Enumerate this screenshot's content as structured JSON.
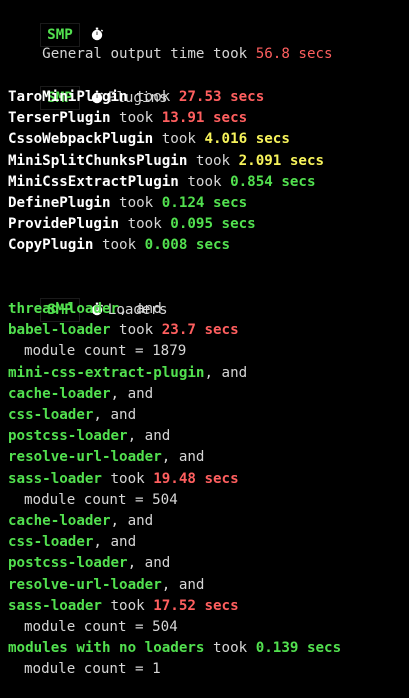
{
  "header": {
    "tag": "SMP",
    "general_line": {
      "prefix": "General output time took ",
      "value": "56.8 secs"
    }
  },
  "plugins": {
    "tag": "SMP",
    "title": "Plugins",
    "items": [
      {
        "name": "TaroMiniPlugin",
        "took": " took ",
        "time": "27.53 secs",
        "color": "#ff5f5f"
      },
      {
        "name": "TerserPlugin",
        "took": " took ",
        "time": "13.91 secs",
        "color": "#ff5f5f"
      },
      {
        "name": "CssoWebpackPlugin",
        "took": " took ",
        "time": "4.016 secs",
        "color": "#f7f35b"
      },
      {
        "name": "MiniSplitChunksPlugin",
        "took": " took ",
        "time": "2.091 secs",
        "color": "#f7f35b"
      },
      {
        "name": "MiniCssExtractPlugin",
        "took": " took ",
        "time": "0.854 secs",
        "color": "#52e04f"
      },
      {
        "name": "DefinePlugin",
        "took": " took ",
        "time": "0.124 secs",
        "color": "#52e04f"
      },
      {
        "name": "ProvidePlugin",
        "took": " took ",
        "time": "0.095 secs",
        "color": "#52e04f"
      },
      {
        "name": "CopyPlugin",
        "took": " took ",
        "time": "0.008 secs",
        "color": "#52e04f"
      }
    ]
  },
  "loaders": {
    "tag": "SMP",
    "title": "Loaders",
    "lines": [
      {
        "type": "name",
        "name": "thread-loader",
        "suffix": ", and"
      },
      {
        "type": "took",
        "name": "babel-loader",
        "took": " took ",
        "time": "23.7 secs",
        "color": "#ff5f5f"
      },
      {
        "type": "count",
        "text": "module count = 1879"
      },
      {
        "type": "name",
        "name": "mini-css-extract-plugin",
        "suffix": ", and"
      },
      {
        "type": "name",
        "name": "cache-loader",
        "suffix": ", and"
      },
      {
        "type": "name",
        "name": "css-loader",
        "suffix": ", and"
      },
      {
        "type": "name",
        "name": "postcss-loader",
        "suffix": ", and"
      },
      {
        "type": "name",
        "name": "resolve-url-loader",
        "suffix": ", and"
      },
      {
        "type": "took",
        "name": "sass-loader",
        "took": " took ",
        "time": "19.48 secs",
        "color": "#ff5f5f"
      },
      {
        "type": "count",
        "text": "module count = 504"
      },
      {
        "type": "name",
        "name": "cache-loader",
        "suffix": ", and"
      },
      {
        "type": "name",
        "name": "css-loader",
        "suffix": ", and"
      },
      {
        "type": "name",
        "name": "postcss-loader",
        "suffix": ", and"
      },
      {
        "type": "name",
        "name": "resolve-url-loader",
        "suffix": ", and"
      },
      {
        "type": "took",
        "name": "sass-loader",
        "took": " took ",
        "time": "17.52 secs",
        "color": "#ff5f5f"
      },
      {
        "type": "count",
        "text": "module count = 504"
      },
      {
        "type": "took",
        "name": "modules with no loaders",
        "took": " took ",
        "time": "0.139 secs",
        "color": "#52e04f"
      },
      {
        "type": "count",
        "text": "module count = 1"
      }
    ]
  },
  "icons": {
    "stopwatch": "stopwatch-icon"
  }
}
